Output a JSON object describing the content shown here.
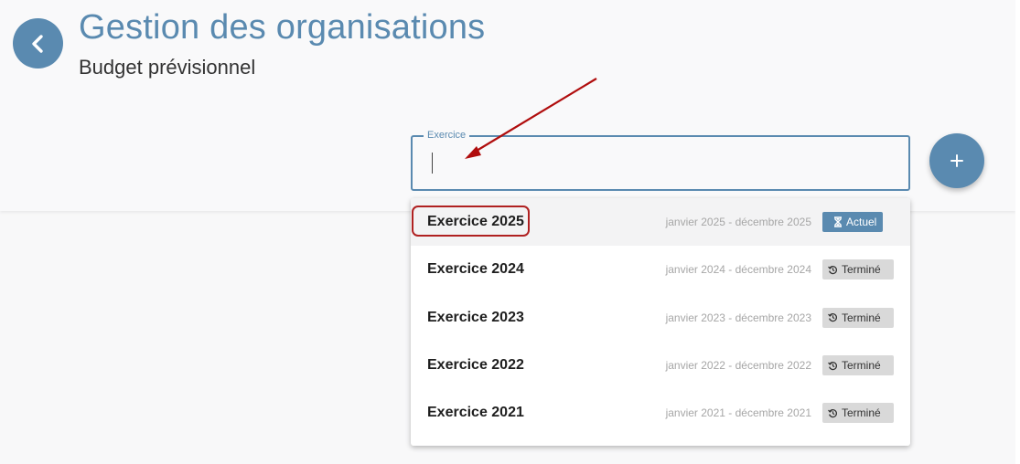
{
  "header": {
    "title": "Gestion des organisations",
    "subtitle": "Budget prévisionnel"
  },
  "field": {
    "legend": "Exercice",
    "value": ""
  },
  "options": [
    {
      "title": "Exercice 2025",
      "dates": "janvier 2025 - décembre 2025",
      "status": "Actuel",
      "status_icon": "hourglass-icon",
      "active": true
    },
    {
      "title": "Exercice 2024",
      "dates": "janvier 2024 - décembre 2024",
      "status": "Terminé",
      "status_icon": "history-icon",
      "active": false
    },
    {
      "title": "Exercice 2023",
      "dates": "janvier 2023 - décembre 2023",
      "status": "Terminé",
      "status_icon": "history-icon",
      "active": false
    },
    {
      "title": "Exercice 2022",
      "dates": "janvier 2022 - décembre 2022",
      "status": "Terminé",
      "status_icon": "history-icon",
      "active": false
    },
    {
      "title": "Exercice 2021",
      "dates": "janvier 2021 - décembre 2021",
      "status": "Terminé",
      "status_icon": "history-icon",
      "active": false
    }
  ],
  "colors": {
    "accent": "#5a8ab0",
    "annotation": "#b02121",
    "badge_done_bg": "#d9d9d9",
    "muted_text": "#a6a6a6"
  }
}
